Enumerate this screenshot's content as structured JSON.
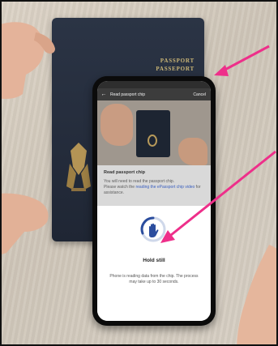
{
  "passport": {
    "cover_line1": "PASSPORT",
    "cover_line2": "PASSEPORT"
  },
  "app": {
    "screen_title": "Read passport chip",
    "cancel_label": "Cancel",
    "section_heading": "Read passport chip",
    "instruction": "You will need to read the passport chip.",
    "help_prefix": "Please watch the ",
    "help_link": "reading the ePassport chip video",
    "help_suffix": " for assistance.",
    "status_title": "Hold still",
    "status_description": "Phone is reading data from the chip. The process may take up to 30 seconds."
  },
  "icons": {
    "back": "back-arrow-icon",
    "hand": "hand-icon",
    "pointer": "pink-arrow-icon"
  },
  "colors": {
    "arrow": "#ee2f8a",
    "link": "#3a5fbf",
    "spinner_track": "#cfd8ea",
    "spinner_arc": "#2b4d9e"
  }
}
